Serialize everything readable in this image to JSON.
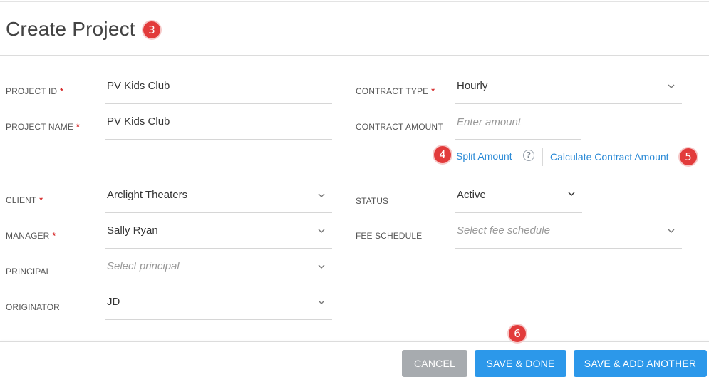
{
  "header": {
    "title": "Create Project"
  },
  "badges": {
    "title_badge": "3",
    "split_badge": "4",
    "calculate_badge": "5",
    "save_badge": "6"
  },
  "form": {
    "project_id": {
      "label": "PROJECT ID",
      "required": "*",
      "value": "PV Kids Club"
    },
    "project_name": {
      "label": "PROJECT NAME",
      "required": "*",
      "value": "PV Kids Club"
    },
    "contract_type": {
      "label": "CONTRACT TYPE",
      "required": "*",
      "value": "Hourly"
    },
    "contract_amount": {
      "label": "CONTRACT AMOUNT",
      "placeholder": "Enter amount",
      "value": ""
    },
    "split_amount_link": "Split Amount",
    "help_icon": "?",
    "calculate_link": "Calculate Contract Amount",
    "client": {
      "label": "CLIENT",
      "required": "*",
      "value": "Arclight Theaters"
    },
    "status": {
      "label": "STATUS",
      "value": "Active"
    },
    "manager": {
      "label": "MANAGER",
      "required": "*",
      "value": "Sally Ryan"
    },
    "fee_schedule": {
      "label": "FEE SCHEDULE",
      "placeholder": "Select fee schedule"
    },
    "principal": {
      "label": "PRINCIPAL",
      "placeholder": "Select principal"
    },
    "originator": {
      "label": "ORIGINATOR",
      "value": "JD"
    }
  },
  "footer": {
    "cancel_label": "CANCEL",
    "save_done_label": "SAVE & DONE",
    "save_add_label": "SAVE & ADD ANOTHER"
  },
  "colors": {
    "accent": "#2c98ea",
    "link": "#2b8ad6",
    "badge": "#e23b3b",
    "required": "#d62b2b",
    "cancel": "#a7abaf"
  },
  "icons": {
    "dropdown": "chevron-down-icon",
    "help": "help-circle-icon"
  }
}
